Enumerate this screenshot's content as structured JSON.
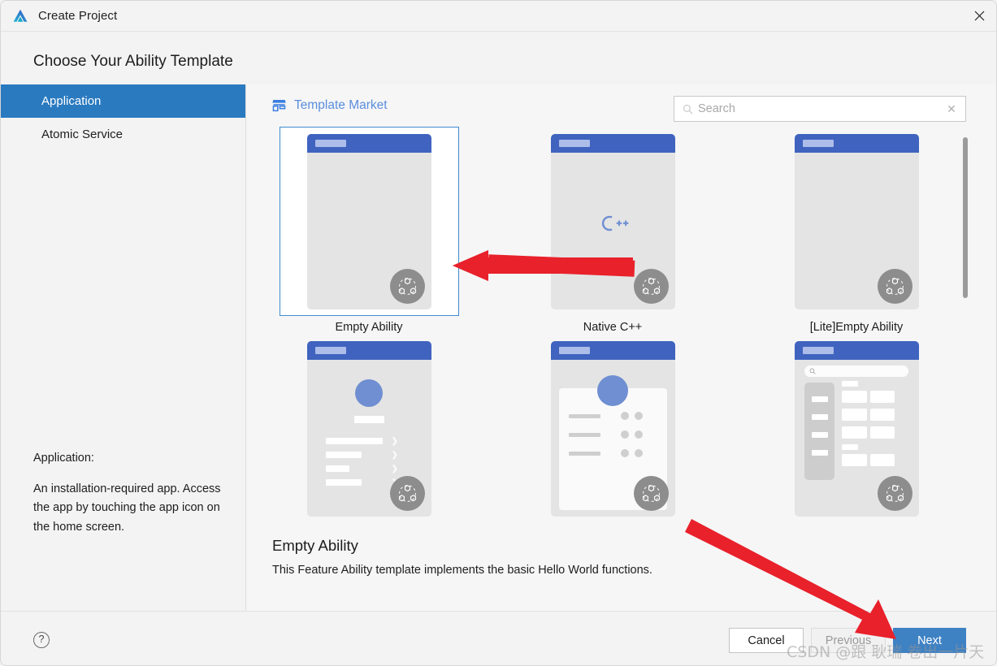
{
  "window": {
    "title": "Create Project",
    "app_icon": "deveco-logo-icon",
    "close_icon": "close-icon"
  },
  "page": {
    "heading": "Choose Your Ability Template"
  },
  "sidebar": {
    "items": [
      {
        "label": "Application",
        "selected": true
      },
      {
        "label": "Atomic Service",
        "selected": false
      }
    ],
    "description": {
      "heading": "Application:",
      "body": "An installation-required app. Access the app by touching the app icon on the home screen."
    }
  },
  "content": {
    "market_link": {
      "label": "Template Market",
      "icon": "store-icon"
    },
    "search": {
      "placeholder": "Search",
      "value": "",
      "search_icon": "search-icon",
      "clear_icon": "clear-icon"
    },
    "templates": [
      {
        "label": "Empty Ability",
        "variant": "blank",
        "selected": true
      },
      {
        "label": "Native C++",
        "variant": "cpp",
        "selected": false,
        "mark": "C++"
      },
      {
        "label": "[Lite]Empty Ability",
        "variant": "blank",
        "selected": false
      },
      {
        "label": "",
        "variant": "profile",
        "selected": false
      },
      {
        "label": "",
        "variant": "card-list",
        "selected": false
      },
      {
        "label": "",
        "variant": "catalog",
        "selected": false
      }
    ],
    "selected_template": {
      "title": "Empty Ability",
      "description": "This Feature Ability template implements the basic Hello World functions."
    }
  },
  "footer": {
    "help_label": "?",
    "buttons": [
      {
        "label": "Cancel",
        "state": "normal"
      },
      {
        "label": "Previous",
        "state": "disabled"
      },
      {
        "label": "Next",
        "state": "primary"
      }
    ]
  },
  "watermark": {
    "text": "CSDN @跟 耿瑞 卷出一片天"
  },
  "colors": {
    "accent_blue": "#2a7ac0",
    "primary_button": "#3f82c4",
    "thumb_header": "#3f63bf",
    "link_blue": "#5b8ede",
    "annotation_red": "#e8212b"
  }
}
